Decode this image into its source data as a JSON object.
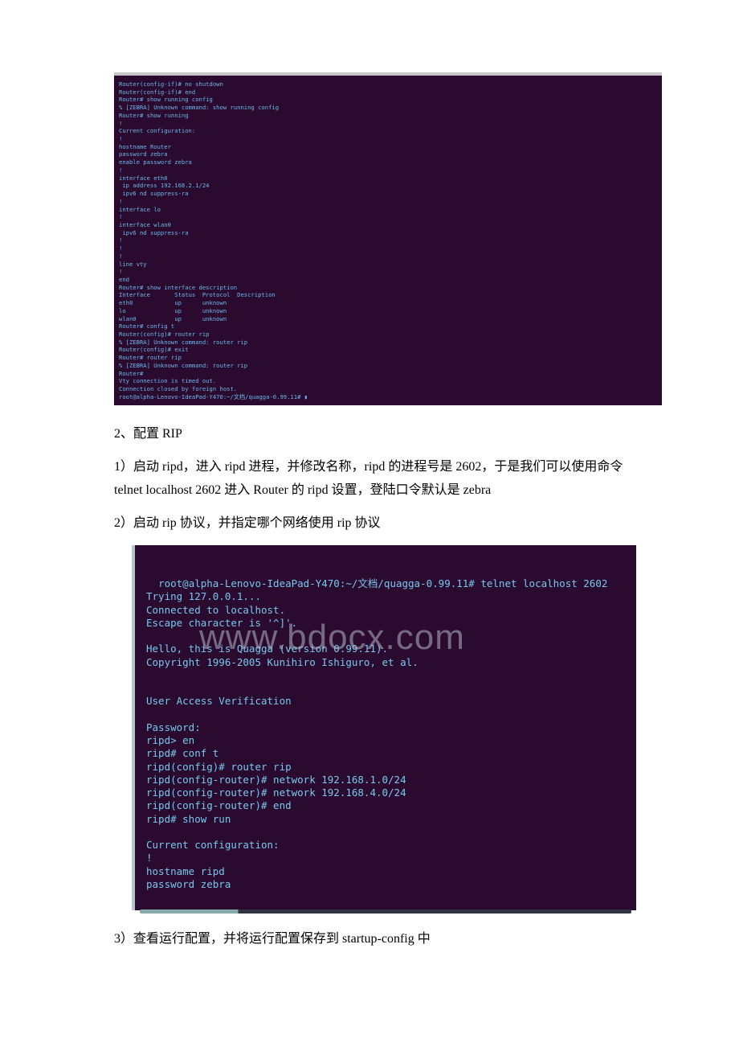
{
  "terminal1": "Router(config-if)# no shutdown\nRouter(config-if)# end\nRouter# show running config\n% [ZEBRA] Unknown command: show running config\nRouter# show running\n!\nCurrent configuration:\n!\nhostname Router\npassword zebra\nenable password zebra\n!\ninterface eth0\n ip address 192.168.2.1/24\n ipv6 nd suppress-ra\n!\ninterface lo\n!\ninterface wlan0\n ipv6 nd suppress-ra\n!\n!\n!\nline vty\n!\nend\nRouter# show interface description\nInterface       Status  Protocol  Description\neth0            up      unknown\nlo              up      unknown\nwlan0           up      unknown\nRouter# config t\nRouter(config)# router rip\n% [ZEBRA] Unknown command: router rip\nRouter(config)# exit\nRouter# router rip\n% [ZEBRA] Unknown command: router rip\nRouter#\nVty connection is timed out.\nConnection closed by foreign host.\nroot@alpha-Lenovo-IdeaPad-Y470:~/文档/quagga-0.99.11# ▮",
  "p1": "2、配置 RIP",
  "p2": "1）启动 ripd，进入 ripd 进程，并修改名称，ripd 的进程号是 2602，于是我们可以使用命令 telnet localhost 2602 进入 Router 的 ripd 设置，登陆口令默认是 zebra",
  "p3": "2）启动 rip 协议，并指定哪个网络使用 rip 协议",
  "terminal2": "root@alpha-Lenovo-IdeaPad-Y470:~/文档/quagga-0.99.11# telnet localhost 2602\nTrying 127.0.0.1...\nConnected to localhost.\nEscape character is '^]'.\n\nHello, this is Quagga (version 0.99.11).\nCopyright 1996-2005 Kunihiro Ishiguro, et al.\n\n\nUser Access Verification\n\nPassword:\nripd> en\nripd# conf t\nripd(config)# router rip\nripd(config-router)# network 192.168.1.0/24\nripd(config-router)# network 192.168.4.0/24\nripd(config-router)# end\nripd# show run\n\nCurrent configuration:\n!\nhostname ripd\npassword zebra",
  "watermark": "www.bdocx.com",
  "p4": "3）查看运行配置，并将运行配置保存到 startup-config 中"
}
